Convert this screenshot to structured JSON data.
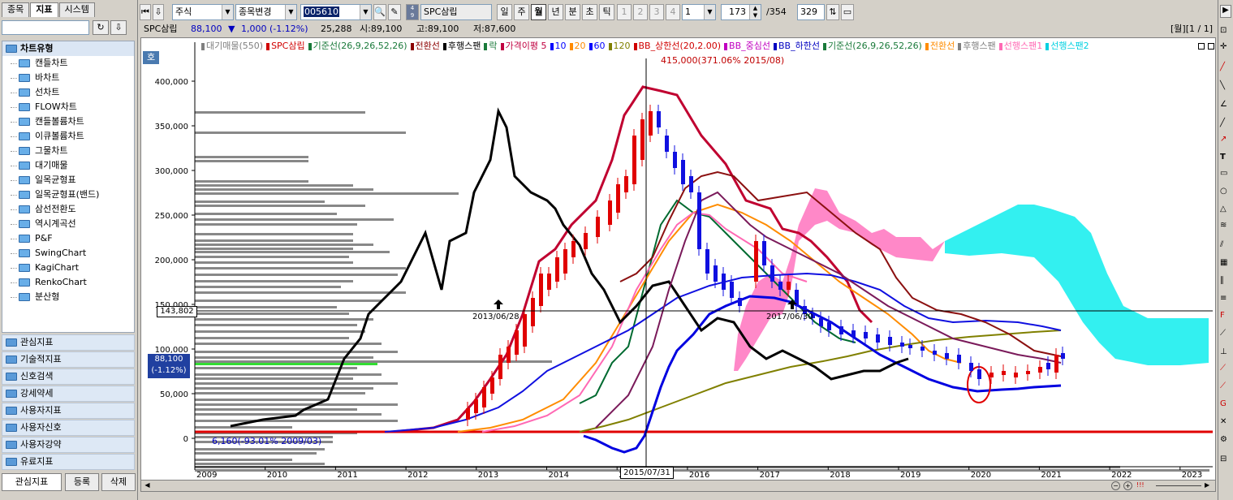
{
  "left_panel": {
    "tabs": [
      "종목",
      "지표",
      "시스템"
    ],
    "tree_header": "차트유형",
    "tree_items": [
      "캔들차트",
      "바차트",
      "선차트",
      "FLOW차트",
      "캔들볼륨차트",
      "이큐볼륨차트",
      "그물차트",
      "대기매물",
      "일목균형표",
      "일목균형표(밴드)",
      "삼선전환도",
      "역시계곡선",
      "P&F",
      "SwingChart",
      "KagiChart",
      "RenkoChart",
      "분산형"
    ],
    "categories": [
      "관심지표",
      "기술적지표",
      "신호검색",
      "강세약세",
      "사용자지표",
      "사용자신호",
      "사용자강약",
      "유료지표"
    ],
    "bottom_tabs": [
      "관심지표",
      "등록",
      "삭제"
    ]
  },
  "toolbar": {
    "asset_type": "주식",
    "change_label": "종목변경",
    "code": "005610",
    "name": "SPC삼립",
    "period_buttons": [
      "일",
      "주",
      "월",
      "년",
      "분",
      "초",
      "틱"
    ],
    "active_period": "월",
    "num_buttons": [
      "1",
      "2",
      "3",
      "4"
    ],
    "count_value": "1",
    "range_value": "173",
    "range_total": "/354",
    "zoom_value": "329"
  },
  "infobar": {
    "name": "SPC삼립",
    "price": "88,100",
    "change_arrow": "▼",
    "change": "1,000 (-1.12%)",
    "volume": "25,288",
    "open": "시:89,100",
    "high": "고:89,100",
    "low": "저:87,600",
    "period_indicator": "[월][1 / 1]"
  },
  "chart": {
    "legend_line1": [
      {
        "text": "대기매물(550)",
        "color": "#808080"
      },
      {
        "text": "SPC삼립",
        "color": "#d00000"
      },
      {
        "text": "기준선(26,9,26,52,26)",
        "color": "#1a7a3a"
      },
      {
        "text": "전환선",
        "color": "#8b0000"
      },
      {
        "text": "후행스팬",
        "color": "#000000"
      },
      {
        "text": "락",
        "color": "#1a7a3a"
      },
      {
        "text": "가격이평 5",
        "color": "#c00040"
      },
      {
        "text": "10",
        "color": "#0000ff"
      },
      {
        "text": "20",
        "color": "#ff8c00"
      },
      {
        "text": "60",
        "color": "#0000ff"
      },
      {
        "text": "120",
        "color": "#808000"
      },
      {
        "text": "BB_상한선(20,2.00)",
        "color": "#d00000"
      },
      {
        "text": "BB_중심선",
        "color": "#c000c0"
      },
      {
        "text": "BB_하한선",
        "color": "#0000c0"
      },
      {
        "text": "기준선(26,9,26,52,26)",
        "color": "#1a7a3a"
      },
      {
        "text": "전환선",
        "color": "#ff8c00"
      },
      {
        "text": "후행스팬",
        "color": "#808080"
      },
      {
        "text": "선행스팬1",
        "color": "#ff69b4"
      },
      {
        "text": "선행스팬2",
        "color": "#00d0e0"
      }
    ],
    "high_note": "415,000(371.06% 2015/08)",
    "low_note": "6,160(-93.01% 2009/03)",
    "y_ticks": [
      "400,000",
      "350,000",
      "300,000",
      "250,000",
      "200,000",
      "150,000",
      "100,000",
      "50,000",
      "0"
    ],
    "x_ticks": [
      "2009",
      "2010",
      "2011",
      "2012",
      "2013",
      "2014",
      "2015",
      "2016",
      "2017",
      "2018",
      "2019",
      "2020",
      "2021",
      "2022",
      "2023"
    ],
    "crosshair_price": "143,802",
    "crosshair_date": "2015/07/31",
    "current_price_box": "88,100",
    "current_change_box": "(-1.12%)",
    "marker1_label": "2013/06/28",
    "marker2_label": "2017/06/30",
    "side_label": "호"
  }
}
